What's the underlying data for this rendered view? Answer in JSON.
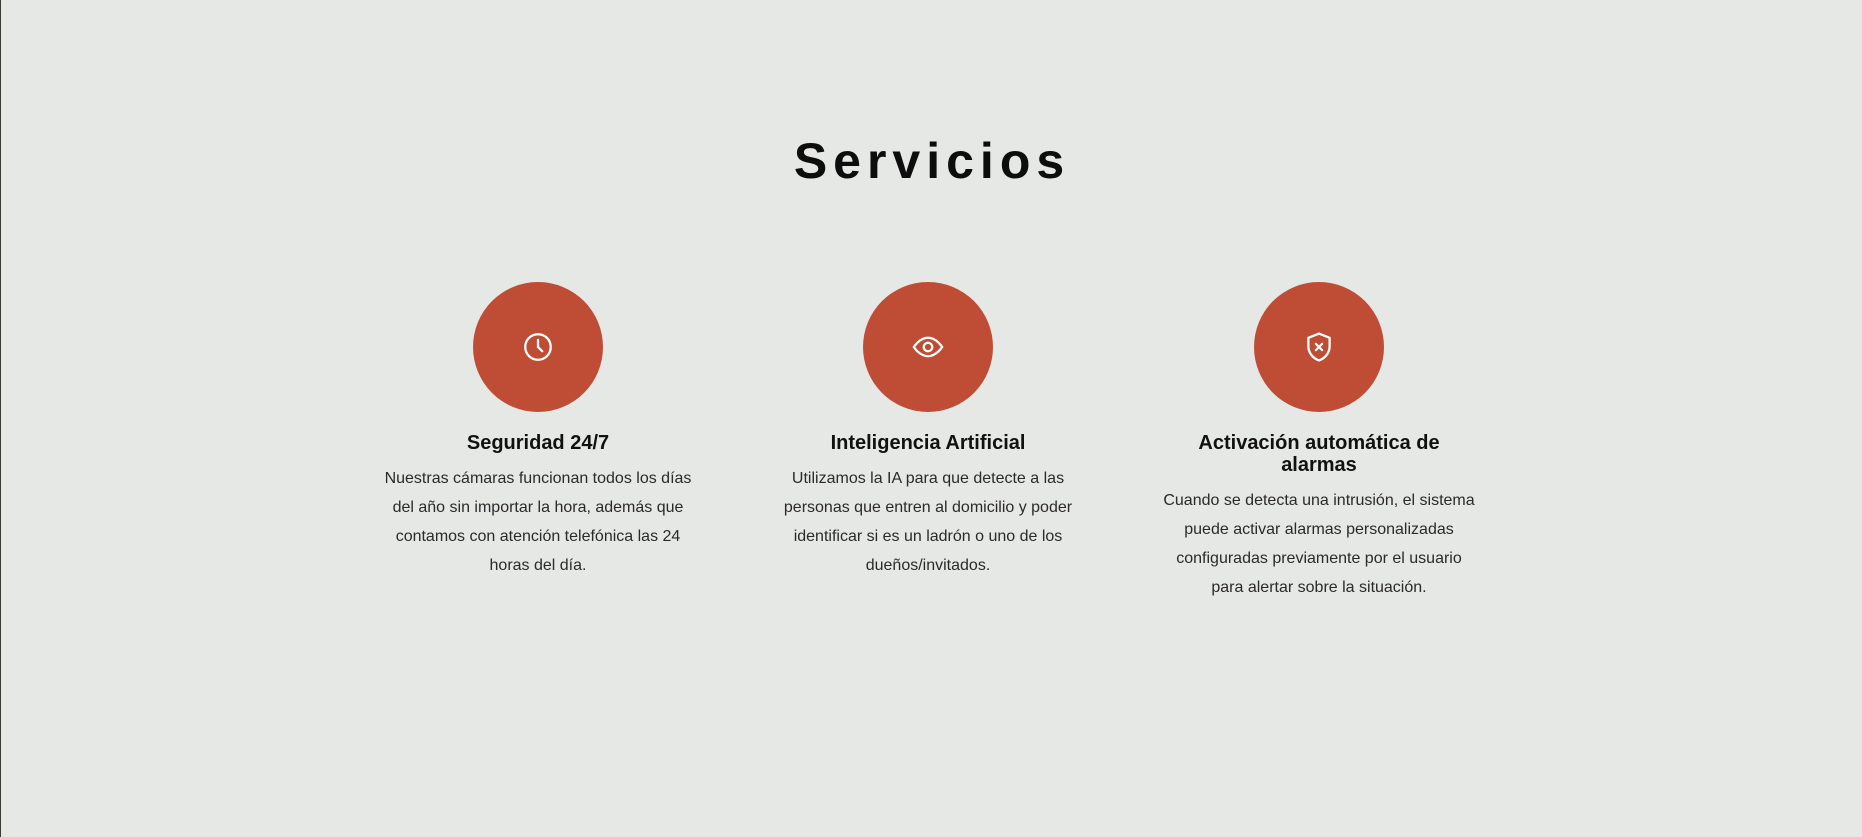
{
  "section": {
    "title": "Servicios"
  },
  "services": [
    {
      "icon": "clock-icon",
      "title": "Seguridad 24/7",
      "description": "Nuestras cámaras funcionan todos los días del año sin importar la hora, además que contamos con atención telefónica las 24 horas del día."
    },
    {
      "icon": "eye-icon",
      "title": "Inteligencia Artificial",
      "description": "Utilizamos la IA para que detecte a las personas que entren al domicilio y poder identificar si es un ladrón o uno de los dueños/invitados."
    },
    {
      "icon": "shield-x-icon",
      "title": "Activación automática de alarmas",
      "description": "Cuando se detecta una intrusión, el sistema puede activar alarmas personalizadas configuradas previamente por el usuario para alertar sobre la situación."
    }
  ],
  "colors": {
    "accent": "#bf4d36",
    "background": "#e6e8e5"
  }
}
